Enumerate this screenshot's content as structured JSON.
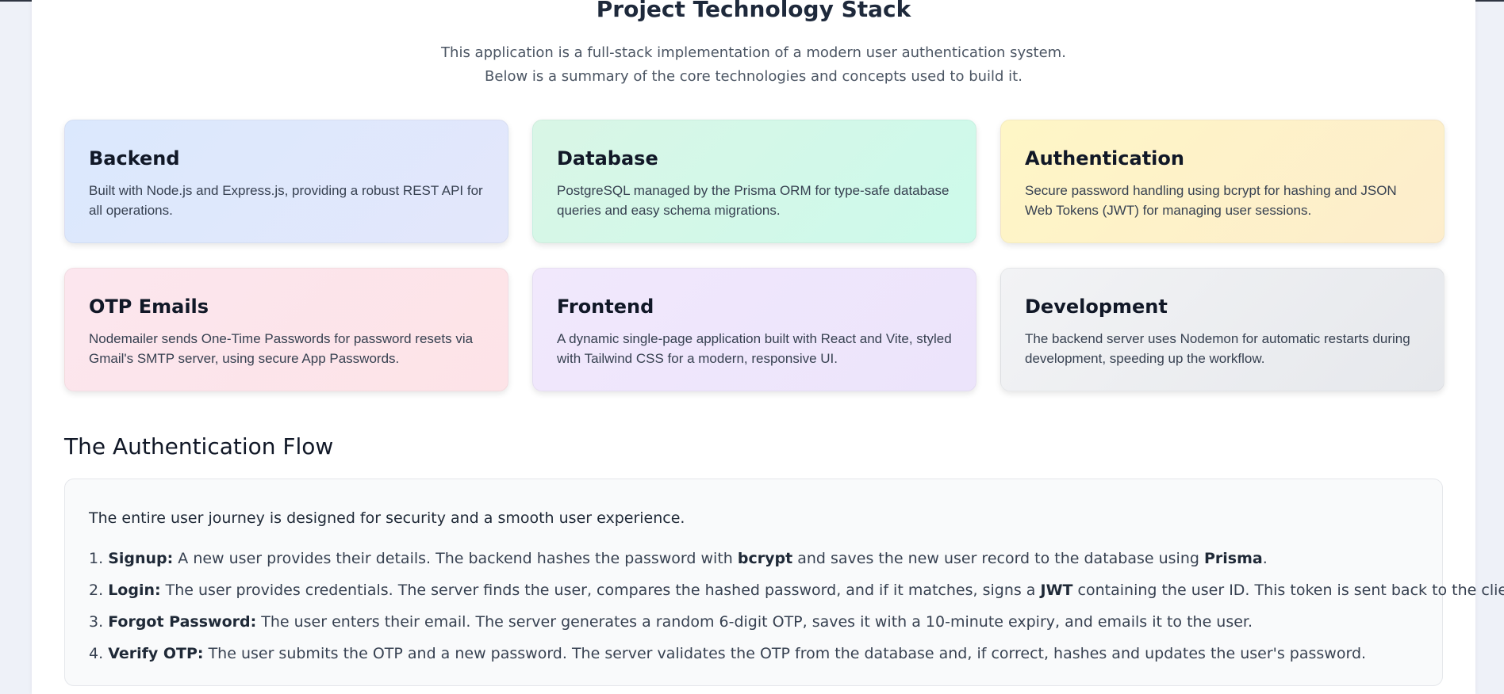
{
  "page": {
    "title": "Project Technology Stack",
    "intro": "This application is a full-stack implementation of a modern user authentication system. Below is a summary of the core technologies and concepts used to build it."
  },
  "cards": [
    {
      "title": "Backend",
      "text": "Built with Node.js and Express.js, providing a robust REST API for all operations.",
      "color": "#dbe8fd"
    },
    {
      "title": "Database",
      "text": "PostgreSQL managed by the Prisma ORM for type-safe database queries and easy schema migrations.",
      "color": "#d9f6e6"
    },
    {
      "title": "Authentication",
      "text": "Secure password handling using bcrypt for hashing and JSON Web Tokens (JWT) for managing user sessions.",
      "color": "#fef6c6"
    },
    {
      "title": "OTP Emails",
      "text": "Nodemailer sends One-Time Passwords for password resets via Gmail's SMTP server, using secure App Passwords.",
      "color": "#fce6ee"
    },
    {
      "title": "Frontend",
      "text": "A dynamic single-page application built with React and Vite, styled with Tailwind CSS for a modern, responsive UI.",
      "color": "#f1e8fc"
    },
    {
      "title": "Development",
      "text": "The backend server uses Nodemon for automatic restarts during development, speeding up the workflow.",
      "color": "#eceef1"
    }
  ],
  "flow": {
    "heading": "The Authentication Flow",
    "intro": "The entire user journey is designed for security and a smooth user experience.",
    "steps": [
      {
        "number": "1.",
        "label": "Signup:",
        "t1": " A new user provides their details. The backend hashes the password with ",
        "k1": "bcrypt",
        "t2": " and saves the new user record to the database using ",
        "k2": "Prisma",
        "t3": "."
      },
      {
        "number": "2.",
        "label": "Login:",
        "t1": " The user provides credentials. The server finds the user, compares the hashed password, and if it matches, signs a ",
        "k1": "JWT",
        "t2": " containing the user ID. This token is sent back to the client."
      },
      {
        "number": "3.",
        "label": "Forgot Password:",
        "t1": " The user enters their email. The server generates a random 6-digit OTP, saves it with a 10-minute expiry, and emails it to the user."
      },
      {
        "number": "4.",
        "label": "Verify OTP:",
        "t1": " The user submits the OTP and a new password. The server validates the OTP from the database and, if correct, hashes and updates the user's password."
      }
    ]
  }
}
